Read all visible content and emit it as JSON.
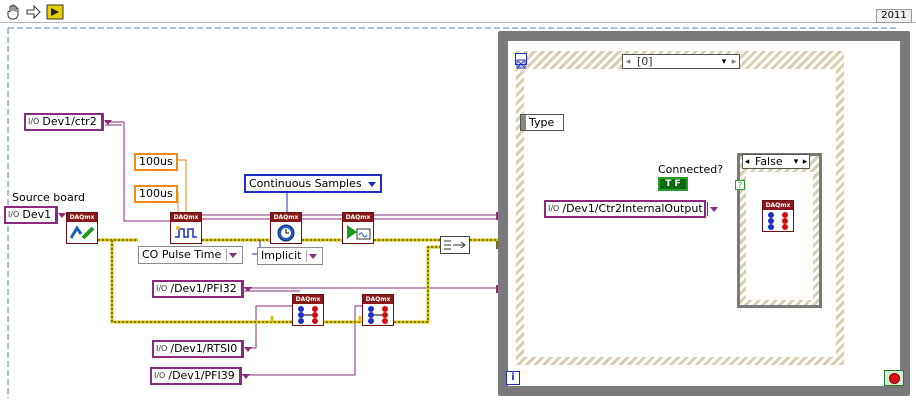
{
  "toolbar": {
    "icons": [
      "hand-icon",
      "arrow-right-icon",
      "run-continuous-icon"
    ],
    "version": "2011"
  },
  "diagram": {
    "ctr2": "Dev1/ctr2",
    "source_board_label": "Source board",
    "dev1": "Dev1",
    "t100a": "100us",
    "t100b": "100us",
    "co_pulse_time": "CO Pulse Time",
    "continuous_samples": "Continuous Samples",
    "implicit": "Implicit",
    "pfi32": "/Dev1/PFI32",
    "rtsi0": "/Dev1/RTSI0",
    "pfi39": "/Dev1/PFI39",
    "ctr2_internal": "/Dev1/Ctr2InternalOutput",
    "connected_label": "Connected?",
    "bool_const": "T F",
    "type_label": "Type",
    "frame_selector": "[0]",
    "case_selector": "False",
    "vi_label": "DAQmx",
    "loop_iteration": "i"
  },
  "colors": {
    "wire_task": "#8a2c7e",
    "wire_error": "#d8c800",
    "wire_bool": "#2a9a2a",
    "wire_numeric": "#f08a10",
    "enum_border": "#1c2fc4",
    "vi_header": "#8b1818"
  }
}
